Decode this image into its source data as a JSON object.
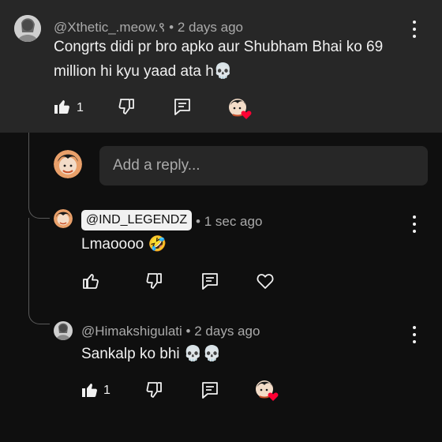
{
  "parent_comment": {
    "username": "@Xthetic_.meow.९",
    "separator": "•",
    "time": "2 days ago",
    "text": "Congrts didi pr bro apko aur Shubham Bhai ko 69 million hi kyu yaad ata h💀",
    "like_count": "1",
    "icons": {
      "like": "thumbs-up-filled-icon",
      "dislike": "thumbs-down-icon",
      "reply": "reply-icon",
      "more": "more-vert-icon"
    }
  },
  "reply_input": {
    "placeholder": "Add a reply..."
  },
  "replies": [
    {
      "username": "@IND_LEGENDZ",
      "separator": "•",
      "time": "1 sec ago",
      "text": "Lmaoooo 🤣",
      "like_count": "",
      "icons": {
        "like": "thumbs-up-icon",
        "dislike": "thumbs-down-icon",
        "reply": "reply-icon",
        "heart": "heart-outline-icon",
        "more": "more-vert-icon"
      }
    },
    {
      "username": "@Himakshigulati",
      "separator": "•",
      "time": "2 days ago",
      "text": "Sankalp ko bhi 💀💀",
      "like_count": "1",
      "icons": {
        "like": "thumbs-up-filled-icon",
        "dislike": "thumbs-down-icon",
        "reply": "reply-icon",
        "more": "more-vert-icon"
      }
    }
  ],
  "colors": {
    "background": "#0f0f0f",
    "parent_background": "#272727",
    "text_primary": "#f1f1f1",
    "text_secondary": "#aaaaaa",
    "heart_badge": "#ff0033"
  }
}
